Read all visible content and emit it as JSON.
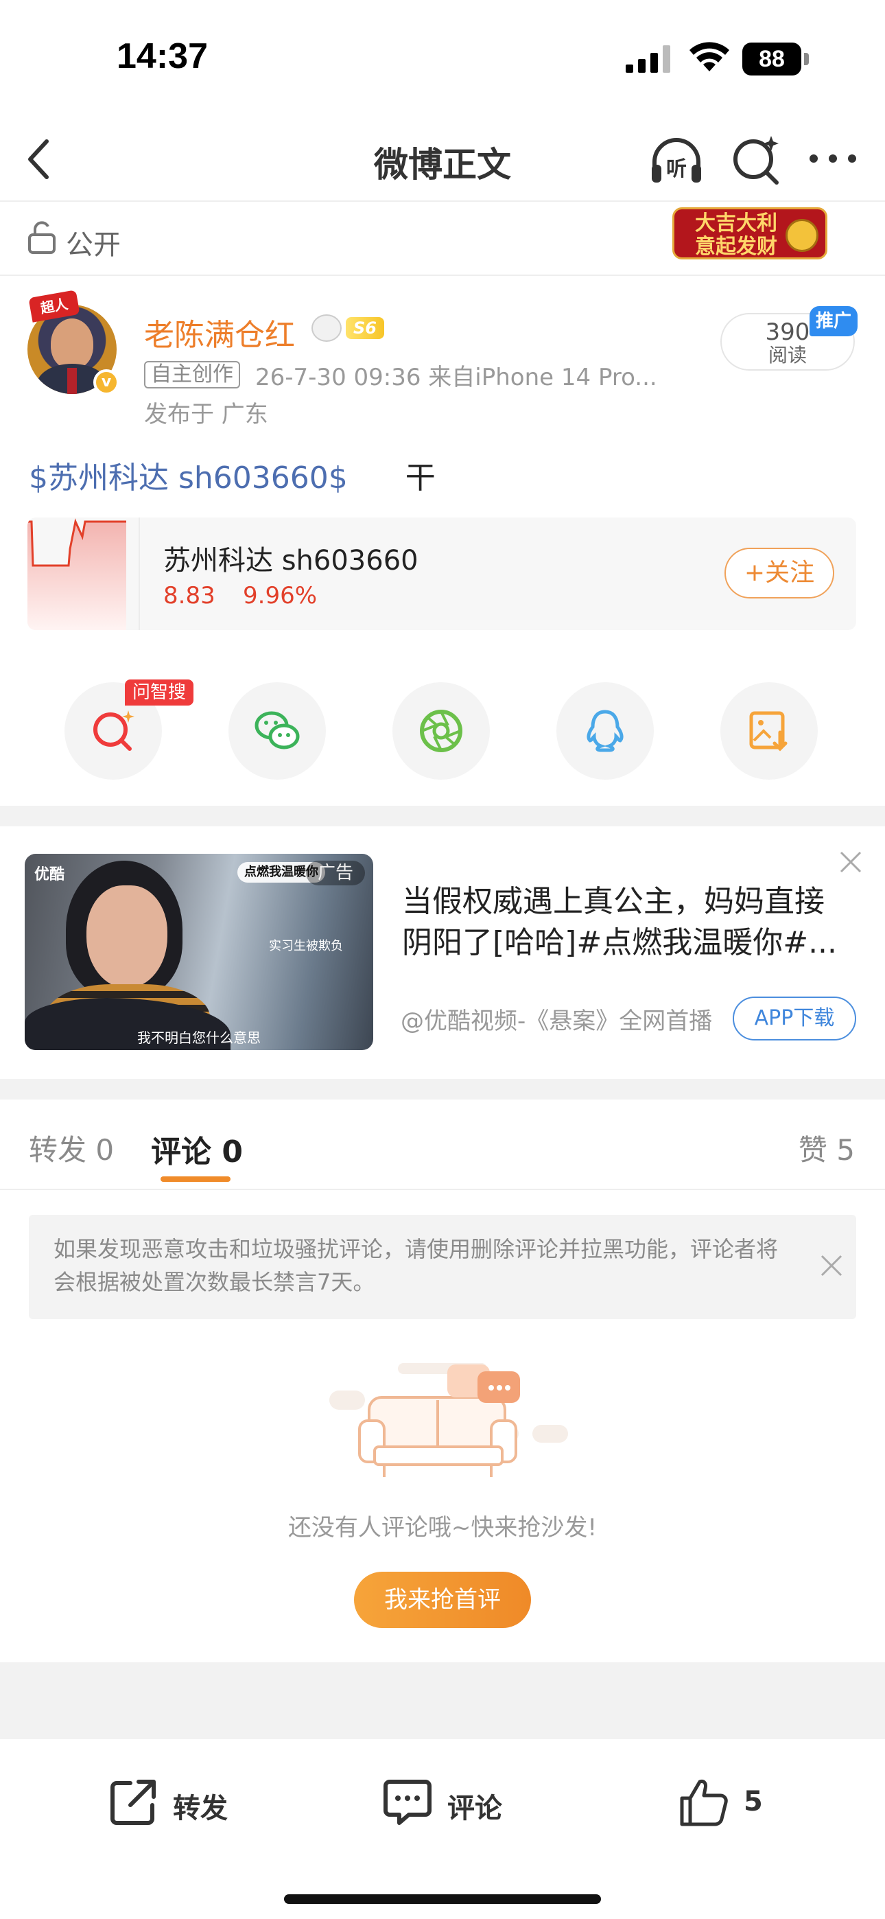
{
  "status_bar": {
    "time": "14:37",
    "battery": "88"
  },
  "nav": {
    "title": "微博正文"
  },
  "visibility": {
    "label": "公开",
    "badge_text": "大吉大利\n意起发财"
  },
  "author": {
    "avatar_label": "超人",
    "verified_mark": "v",
    "name": "老陈满仓红",
    "level": "S6",
    "original_tag": "自主创作",
    "meta": "26-7-30 09:36  来自iPhone 14 Pro...",
    "location": "发布于 广东",
    "read_count": "390",
    "read_label": "阅读",
    "promo_tag": "推广"
  },
  "post": {
    "stock_link": "$苏州科达 sh603660$",
    "text": "干"
  },
  "stock_card": {
    "name": "苏州科达 sh603660",
    "price": "8.83",
    "change": "9.96%",
    "follow_label": "+关注",
    "accent": "#e2402a"
  },
  "share": {
    "ai_search_tag": "问智搜",
    "icons": [
      "ai-search-icon",
      "wechat-icon",
      "moments-icon",
      "qq-icon",
      "save-image-icon"
    ]
  },
  "ad": {
    "logo": "优酷",
    "label": "广告",
    "overlay_tag": "点燃我温暖你",
    "side_caption": "实习生被欺负",
    "subtitle": "我不明白您什么意思",
    "title": "当假权威遇上真公主，妈妈直接阴阳了[哈哈]#点燃我温暖你#...",
    "source": "@优酷视频-《悬案》全网首播",
    "download_label": "APP下载"
  },
  "tabs": {
    "repost": "转发 0",
    "comment": "评论 0",
    "like": "赞 5"
  },
  "notice": {
    "text": "如果发现恶意攻击和垃圾骚扰评论，请使用删除评论并拉黑功能，评论者将会根据被处置次数最长禁言7天。"
  },
  "empty_state": {
    "text": "还没有人评论哦~快来抢沙发!",
    "button": "我来抢首评"
  },
  "bottom_bar": {
    "repost": "转发",
    "comment": "评论",
    "like": "5"
  },
  "colors": {
    "brand_orange": "#ed7e2a",
    "link_blue": "#4d6eb0",
    "stock_red": "#e2402a"
  }
}
